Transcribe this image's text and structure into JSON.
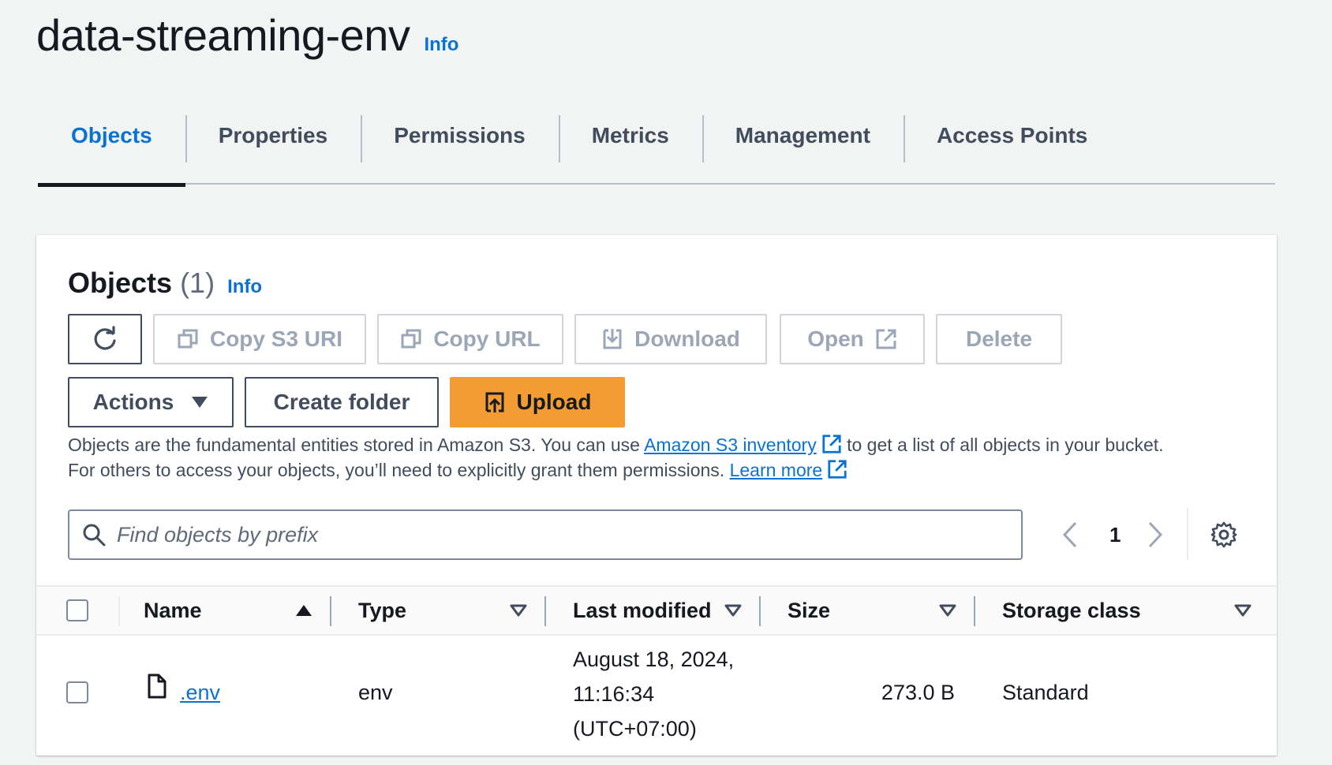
{
  "header": {
    "title": "data-streaming-env",
    "info": "Info"
  },
  "tabs": [
    {
      "label": "Objects",
      "active": true
    },
    {
      "label": "Properties"
    },
    {
      "label": "Permissions"
    },
    {
      "label": "Metrics"
    },
    {
      "label": "Management"
    },
    {
      "label": "Access Points"
    }
  ],
  "objects_panel": {
    "title": "Objects",
    "count": "(1)",
    "info": "Info",
    "toolbar": {
      "copy_s3_uri": "Copy S3 URI",
      "copy_url": "Copy URL",
      "download": "Download",
      "open": "Open",
      "delete": "Delete",
      "actions": "Actions",
      "create_folder": "Create folder",
      "upload": "Upload"
    },
    "description": {
      "text1": "Objects are the fundamental entities stored in Amazon S3. You can use ",
      "link1": "Amazon S3 inventory",
      "text2": " to get a list of all objects in your bucket.",
      "text3": "For others to access your objects, you’ll need to explicitly grant them permissions. ",
      "link2": "Learn more"
    },
    "search": {
      "placeholder": "Find objects by prefix",
      "value": ""
    },
    "pagination": {
      "current_page": "1"
    },
    "table": {
      "columns": [
        "Name",
        "Type",
        "Last modified",
        "Size",
        "Storage class"
      ],
      "rows": [
        {
          "name": ".env",
          "type": "env",
          "last_modified_line1": "August 18, 2024,",
          "last_modified_line2": "11:16:34",
          "last_modified_line3": "(UTC+07:00)",
          "size": "273.0 B",
          "storage_class": "Standard"
        }
      ]
    }
  },
  "colors": {
    "accent": "#0972d3",
    "primary_button": "#f39c33",
    "disabled_text": "#9ba7b6"
  },
  "icons": [
    "refresh-icon",
    "copy-icon",
    "download-icon",
    "external-link-icon",
    "caret-down-icon",
    "upload-icon",
    "search-icon",
    "chevron-left-icon",
    "chevron-right-icon",
    "gear-icon",
    "sort-asc-icon",
    "sort-desc-icon",
    "file-icon"
  ]
}
